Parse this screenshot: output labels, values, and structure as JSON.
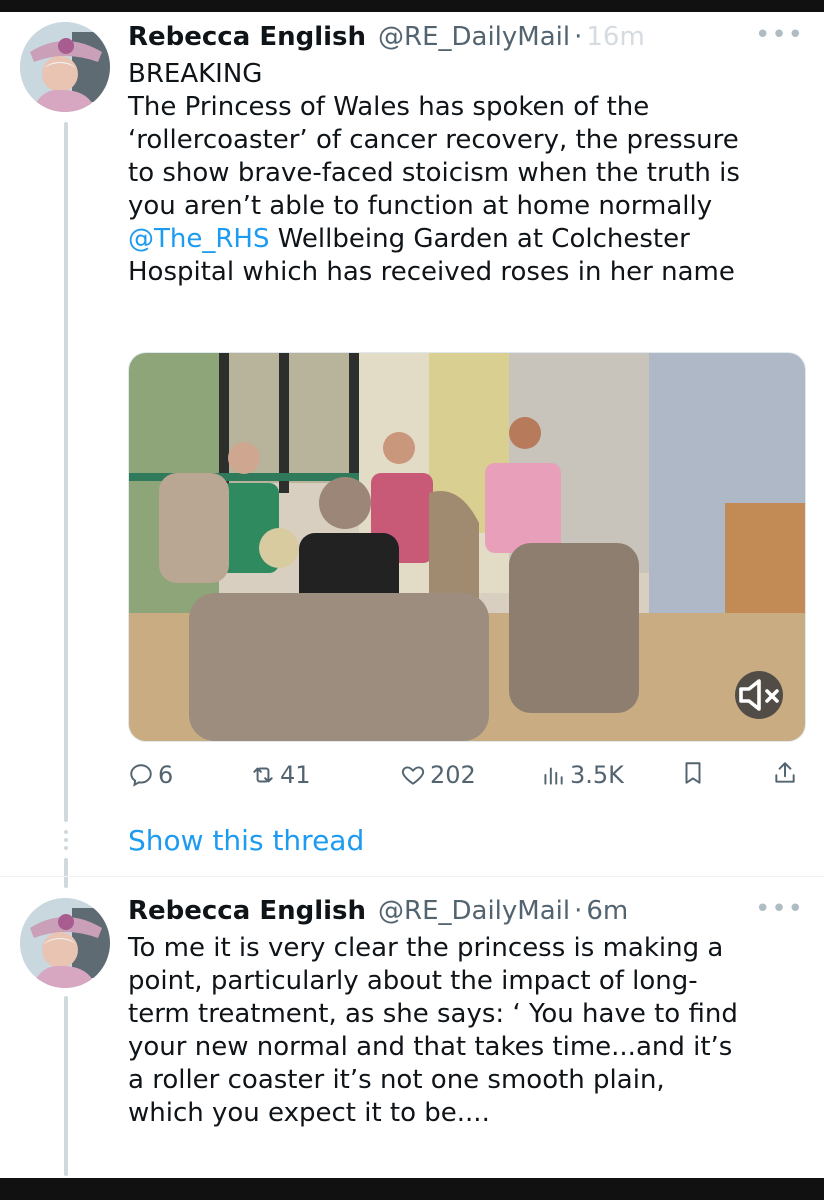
{
  "tweets": [
    {
      "name": "Rebecca English",
      "handle": "@RE_DailyMail",
      "separator": "·",
      "time": "16m",
      "more": "•••",
      "text_lines": [
        "BREAKING",
        "The Princess of Wales has spoken of the",
        "‘rollercoaster’ of cancer recovery, the pressure",
        "to show brave-faced stoicism when the truth is",
        "you aren’t able to function at home normally"
      ],
      "mention": "@The_RHS",
      "mention_rest": " Wellbeing Garden at Colchester",
      "last_line": "Hospital which has received roses in her name",
      "media": {
        "type": "video",
        "muted": true,
        "mute_icon": "speaker-muted-icon"
      },
      "actions": {
        "replies": "6",
        "retweets": "41",
        "likes": "202",
        "views": "3.5K"
      },
      "show_thread": "Show this thread"
    },
    {
      "name": "Rebecca English",
      "handle": "@RE_DailyMail",
      "separator": "·",
      "time": "6m",
      "more": "•••",
      "text_lines": [
        "To me it is very clear the princess is making a",
        "point, particularly about the impact of long-",
        "term treatment, as she says: ‘ You have to find",
        "your new normal and that takes time...and it’s",
        "a roller coaster it’s not one smooth plain,",
        "which you expect it to be...."
      ]
    }
  ],
  "colors": {
    "link": "#1d9bf0",
    "secondary_text": "#536471",
    "primary_text": "#0f1419",
    "thread_line": "#cfd9de"
  },
  "icons": [
    "reply-icon",
    "retweet-icon",
    "like-icon",
    "views-icon",
    "bookmark-icon",
    "share-icon"
  ]
}
